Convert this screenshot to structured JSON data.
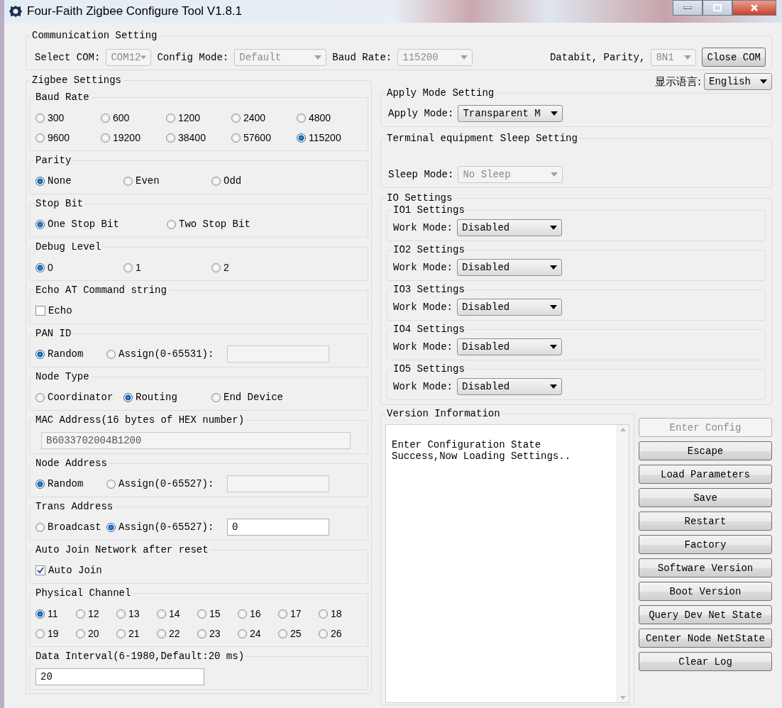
{
  "window": {
    "title": "Four-Faith Zigbee Configure Tool V1.8.1"
  },
  "communication": {
    "title": "Communication Setting",
    "fields": [
      {
        "label": "Select COM:",
        "value": "COM12",
        "disabled": true
      },
      {
        "label": "Config Mode:",
        "value": "Default",
        "disabled": true
      },
      {
        "label": "Baud Rate:",
        "value": "115200",
        "disabled": true
      },
      {
        "label": "Databit, Parity,",
        "value": "8N1",
        "disabled": true
      }
    ],
    "button": "Close COM"
  },
  "zigbee": {
    "title": "Zigbee Settings",
    "groups": [
      {
        "kind": "radio",
        "title": "Baud Rate",
        "options": [
          {
            "label": "300",
            "selected": false
          },
          {
            "label": "600",
            "selected": false
          },
          {
            "label": "1200",
            "selected": false
          },
          {
            "label": "2400",
            "selected": false
          },
          {
            "label": "4800",
            "selected": false
          },
          {
            "label": "9600",
            "selected": false
          },
          {
            "label": "19200",
            "selected": false
          },
          {
            "label": "38400",
            "selected": false
          },
          {
            "label": "57600",
            "selected": false
          },
          {
            "label": "115200",
            "selected": true
          }
        ]
      },
      {
        "kind": "radio",
        "title": "Parity",
        "options": [
          {
            "label": "None",
            "selected": true
          },
          {
            "label": "Even",
            "selected": false
          },
          {
            "label": "Odd",
            "selected": false
          }
        ]
      },
      {
        "kind": "radio",
        "title": "Stop Bit",
        "options": [
          {
            "label": "One Stop Bit",
            "selected": true
          },
          {
            "label": "Two Stop Bit",
            "selected": false
          }
        ]
      },
      {
        "kind": "radio",
        "title": "Debug Level",
        "options": [
          {
            "label": "0",
            "selected": true
          },
          {
            "label": "1",
            "selected": false
          },
          {
            "label": "2",
            "selected": false
          }
        ]
      },
      {
        "kind": "checkbox",
        "title": "Echo AT Command string",
        "label": "Echo",
        "checked": false
      },
      {
        "kind": "radio_input",
        "title": "PAN ID",
        "options": [
          {
            "label": "Random",
            "selected": true
          },
          {
            "label": "Assign(0-65531):",
            "selected": false
          }
        ],
        "input": {
          "disabled": true
        }
      },
      {
        "kind": "radio",
        "title": "Node Type",
        "options": [
          {
            "label": "Coordinator",
            "selected": false
          },
          {
            "label": "Routing",
            "selected": true
          },
          {
            "label": "End Device",
            "selected": false
          }
        ]
      },
      {
        "kind": "text",
        "title": "MAC Address(16 bytes of HEX number)",
        "value": "B6033702004B1200",
        "disabled": true
      },
      {
        "kind": "radio_input",
        "title": "Node Address",
        "options": [
          {
            "label": "Random",
            "selected": true
          },
          {
            "label": "Assign(0-65527):",
            "selected": false
          }
        ],
        "input": {
          "disabled": true
        }
      },
      {
        "kind": "radio_input",
        "title": "Trans Address",
        "options": [
          {
            "label": "Broadcast",
            "selected": false
          },
          {
            "label": "Assign(0-65527):",
            "selected": true
          }
        ],
        "input": {
          "value": "0",
          "disabled": false
        }
      },
      {
        "kind": "checkbox",
        "title": "Auto Join Network after reset",
        "label": "Auto Join",
        "checked": true
      },
      {
        "kind": "radio",
        "title": "Physical Channel",
        "options": [
          {
            "label": "11",
            "selected": true
          },
          {
            "label": "12",
            "selected": false
          },
          {
            "label": "13",
            "selected": false
          },
          {
            "label": "14",
            "selected": false
          },
          {
            "label": "15",
            "selected": false
          },
          {
            "label": "16",
            "selected": false
          },
          {
            "label": "17",
            "selected": false
          },
          {
            "label": "18",
            "selected": false
          },
          {
            "label": "19",
            "selected": false
          },
          {
            "label": "20",
            "selected": false
          },
          {
            "label": "21",
            "selected": false
          },
          {
            "label": "22",
            "selected": false
          },
          {
            "label": "23",
            "selected": false
          },
          {
            "label": "24",
            "selected": false
          },
          {
            "label": "25",
            "selected": false
          },
          {
            "label": "26",
            "selected": false
          }
        ]
      },
      {
        "kind": "text",
        "title": "Data Interval(6-1980,Default:20 ms)",
        "value": "20",
        "disabled": false
      }
    ]
  },
  "language": {
    "label": "显示语言:",
    "value": "English",
    "disabled": false
  },
  "apply_mode": {
    "title": "Apply Mode Setting",
    "label": "Apply Mode:",
    "value": "Transparent M",
    "disabled": false
  },
  "sleep": {
    "title": "Terminal equipment Sleep Setting",
    "label": "Sleep Mode:",
    "value": "No Sleep",
    "disabled": true
  },
  "io": {
    "title": "IO Settings",
    "items": [
      {
        "title": "IO1 Settings",
        "label": "Work Mode:",
        "value": "Disabled",
        "disabled": false
      },
      {
        "title": "IO2 Settings",
        "label": "Work Mode:",
        "value": "Disabled",
        "disabled": false
      },
      {
        "title": "IO3 Settings",
        "label": "Work Mode:",
        "value": "Disabled",
        "disabled": false
      },
      {
        "title": "IO4 Settings",
        "label": "Work Mode:",
        "value": "Disabled",
        "disabled": false
      },
      {
        "title": "IO5 Settings",
        "label": "Work Mode:",
        "value": "Disabled",
        "disabled": false
      }
    ]
  },
  "version": {
    "title": "Version Information",
    "log": [
      "Enter Configuration State",
      "Success,Now Loading Settings.."
    ]
  },
  "buttons": [
    {
      "label": "Enter Config",
      "disabled": true
    },
    {
      "label": "Escape",
      "disabled": false
    },
    {
      "label": "Load Parameters",
      "disabled": false
    },
    {
      "label": "Save",
      "disabled": false
    },
    {
      "label": "Restart",
      "disabled": false
    },
    {
      "label": "Factory",
      "disabled": false
    },
    {
      "label": "Software Version",
      "disabled": false
    },
    {
      "label": "Boot Version",
      "disabled": false
    },
    {
      "label": "Query Dev Net State",
      "disabled": false
    },
    {
      "label": "Center Node NetState",
      "disabled": false
    },
    {
      "label": "Clear Log",
      "disabled": false
    }
  ]
}
